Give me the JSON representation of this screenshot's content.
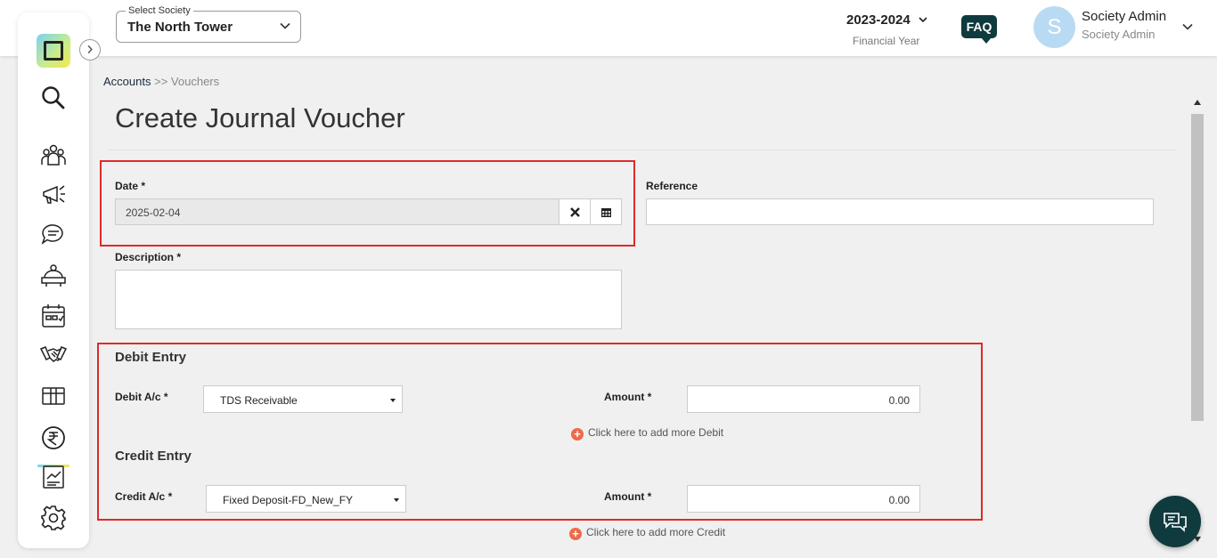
{
  "header": {
    "society_label": "Select Society",
    "society_value": "The North Tower",
    "financial_year": "2023-2024",
    "financial_year_label": "Financial Year",
    "faq_label": "FAQ",
    "avatar_initial": "S",
    "user_name": "Society Admin",
    "user_role": "Society Admin"
  },
  "sidebar": {
    "items": [
      {
        "icon": "search-icon"
      },
      {
        "icon": "community-icon"
      },
      {
        "icon": "announcement-icon"
      },
      {
        "icon": "chat-icon"
      },
      {
        "icon": "helpdesk-icon"
      },
      {
        "icon": "calendar-icon"
      },
      {
        "icon": "handshake-icon"
      },
      {
        "icon": "package-icon"
      },
      {
        "icon": "rupee-icon",
        "active": true
      },
      {
        "icon": "report-icon"
      },
      {
        "icon": "settings-icon"
      }
    ]
  },
  "breadcrumb": {
    "root": "Accounts",
    "separator": ">>",
    "current": "Vouchers"
  },
  "page_title": "Create Journal Voucher",
  "form": {
    "date_label": "Date *",
    "date_value": "2025-02-04",
    "reference_label": "Reference",
    "reference_value": "",
    "description_label": "Description *",
    "description_value": "",
    "debit": {
      "title": "Debit Entry",
      "account_label": "Debit A/c *",
      "account_value": "TDS Receivable",
      "amount_label": "Amount *",
      "amount_value": "0.00",
      "add_more": "Click here to add more Debit"
    },
    "credit": {
      "title": "Credit Entry",
      "account_label": "Credit A/c *",
      "account_value": "Fixed Deposit-FD_New_FY",
      "amount_label": "Amount *",
      "amount_value": "0.00",
      "add_more": "Click here to add more Credit"
    }
  },
  "colors": {
    "highlight": "#e02a2a",
    "brand_dark": "#0f3a3e",
    "add_icon": "#ef6a4a"
  }
}
